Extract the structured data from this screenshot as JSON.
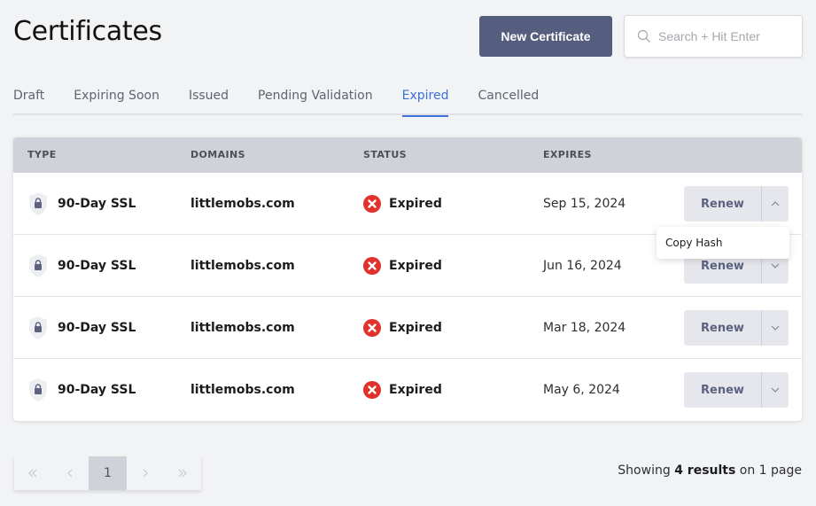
{
  "header": {
    "title": "Certificates",
    "new_button_label": "New Certificate",
    "search_placeholder": "Search + Hit Enter",
    "search_value": ""
  },
  "tabs": [
    {
      "label": "Draft",
      "active": false
    },
    {
      "label": "Expiring Soon",
      "active": false
    },
    {
      "label": "Issued",
      "active": false
    },
    {
      "label": "Pending Validation",
      "active": false
    },
    {
      "label": "Expired",
      "active": true
    },
    {
      "label": "Cancelled",
      "active": false
    }
  ],
  "table": {
    "columns": [
      "TYPE",
      "DOMAINS",
      "STATUS",
      "EXPIRES"
    ],
    "rows": [
      {
        "type": "90-Day SSL",
        "domain": "littlemobs.com",
        "status": "Expired",
        "expires": "Sep 15, 2024",
        "action": "Renew",
        "menu_open": true
      },
      {
        "type": "90-Day SSL",
        "domain": "littlemobs.com",
        "status": "Expired",
        "expires": "Jun 16, 2024",
        "action": "Renew",
        "menu_open": false
      },
      {
        "type": "90-Day SSL",
        "domain": "littlemobs.com",
        "status": "Expired",
        "expires": "Mar 18, 2024",
        "action": "Renew",
        "menu_open": false
      },
      {
        "type": "90-Day SSL",
        "domain": "littlemobs.com",
        "status": "Expired",
        "expires": "May 6, 2024",
        "action": "Renew",
        "menu_open": false
      }
    ]
  },
  "dropdown": {
    "items": [
      "Copy Hash"
    ]
  },
  "pagination": {
    "current_page": "1",
    "summary_prefix": "Showing",
    "summary_count": "4 results",
    "summary_suffix": "on 1 page"
  },
  "colors": {
    "accent": "#3f6fd8",
    "primary_button": "#565e80",
    "status_expired": "#e0312a",
    "header_bg": "#cfd3d9"
  },
  "icons": {
    "search": "search-icon",
    "type": "shield-lock-icon",
    "status": "x-circle-icon",
    "toggle_open": "chevron-up-icon",
    "toggle_closed": "chevron-down-icon",
    "first": "chevrons-left-icon",
    "prev": "chevron-left-icon",
    "next": "chevron-right-icon",
    "last": "chevrons-right-icon"
  }
}
